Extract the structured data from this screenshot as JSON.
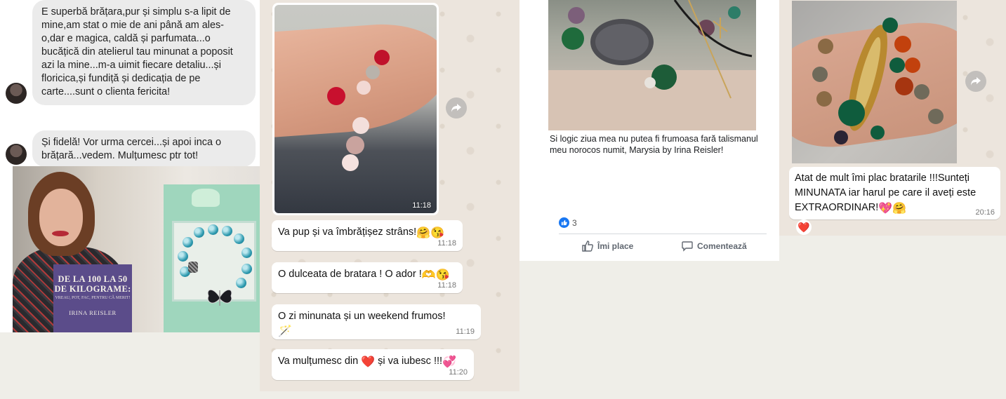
{
  "panel1": {
    "message1": "E superbă brățara,pur și simplu s-a lipit de mine,am stat o mie de ani până am ales-o,dar e magica, caldă și parfumata...o bucățică din atelierul tau minunat a poposit azi la mine...m-a uimit fiecare detaliu...și floricica,și fundiță și dedicația de pe carte....sunt o clienta fericita!",
    "message2": "Și fidelă! Vor urma cercei...și apoi inca o brățară...vedem.  Mulțumesc ptr tot!",
    "book": {
      "title": "DE LA 100 LA 50 DE KILOGRAME:",
      "subtitle": "VREAU, POT, FAC, PENTRU CĂ MERIT!",
      "author": "IRINA REISLER"
    }
  },
  "panel2": {
    "image_time": "11:18",
    "messages": [
      {
        "text": "Va pup și va îmbrățișez strâns!",
        "emoji": "🤗😘",
        "time": "11:18"
      },
      {
        "text": "O dulceata de bratara ! O ador !",
        "emoji": "🫶😘",
        "time": "11:18"
      },
      {
        "text": "O zi minunata și un weekend  frumos!",
        "emoji": "🪄",
        "time": "11:19"
      },
      {
        "text": "Va mulțumesc din",
        "emoji_mid": "❤️",
        "text2": " și va iubesc !!!",
        "emoji": "💞",
        "time": "11:20"
      }
    ]
  },
  "panel3": {
    "caption": "Si logic ziua mea nu putea fi frumoasa fară talismanul meu norocos numit, Marysia by Irina Reisler!",
    "reaction_count": "3",
    "like_label": "Îmi place",
    "comment_label": "Comentează",
    "colors": {
      "like_blue": "#1877f2"
    }
  },
  "panel4": {
    "message": "Atat de mult îmi plac bratarile !!!Sunteți MINUNATA iar harul pe care il aveți este EXTRAORDINAR!",
    "emoji": "💖🤗",
    "time": "20:16",
    "reaction": "❤️"
  },
  "icons": {
    "forward": "forward-icon",
    "like": "thumbs-up-icon",
    "comment": "comment-icon"
  }
}
